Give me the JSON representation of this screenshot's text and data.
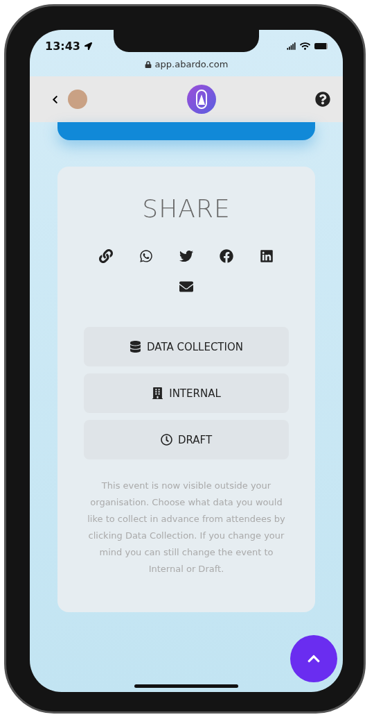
{
  "status_bar": {
    "time": "13:43"
  },
  "browser": {
    "url": "app.abardo.com"
  },
  "share": {
    "title": "SHARE",
    "icons": [
      {
        "kind": "link"
      },
      {
        "kind": "whatsapp"
      },
      {
        "kind": "twitter"
      },
      {
        "kind": "facebook"
      },
      {
        "kind": "linkedin"
      },
      {
        "kind": "email"
      }
    ],
    "buttons": [
      {
        "kind": "database",
        "label": "DATA COLLECTION"
      },
      {
        "kind": "building",
        "label": "INTERNAL"
      },
      {
        "kind": "clock",
        "label": "DRAFT"
      }
    ],
    "description": "This event is now visible outside your organisation. Choose what data you would like to collect in advance from attendees by clicking Data Collection. If you change your mind you can still change the event to Internal or Draft."
  }
}
